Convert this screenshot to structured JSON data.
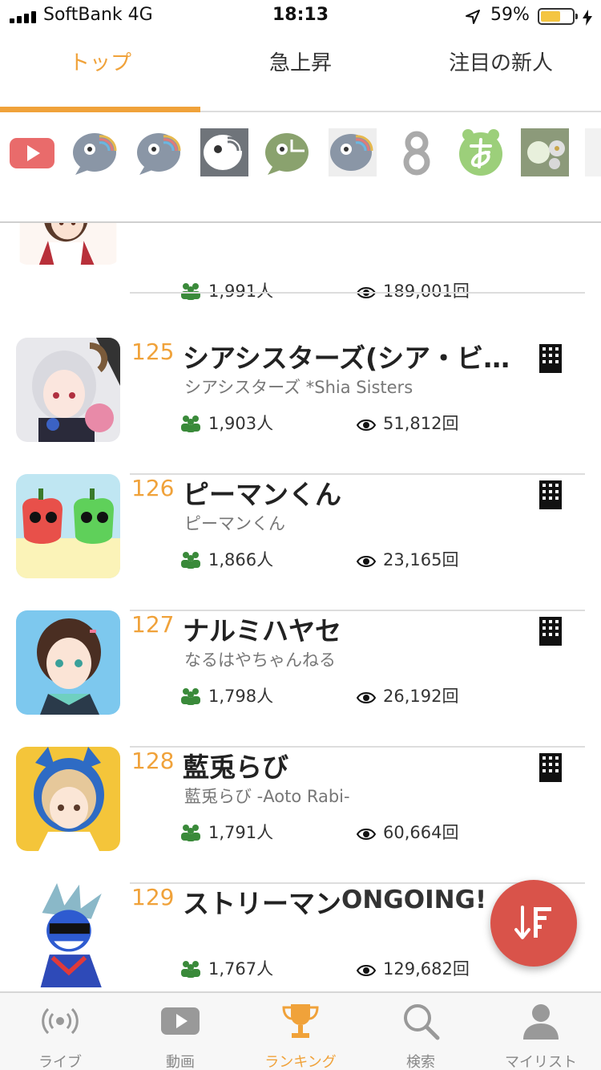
{
  "status_bar": {
    "carrier": "SoftBank  4G",
    "time": "18:13",
    "battery_percent": "59%"
  },
  "tabs": [
    {
      "label": "トップ",
      "active": true
    },
    {
      "label": "急上昇",
      "active": false
    },
    {
      "label": "注目の新人",
      "active": false
    }
  ],
  "channel_icons": [
    "youtube-icon",
    "showroom-icon",
    "showroom-icon",
    "showroom-icon",
    "showroom-icon",
    "showroom-icon",
    "eight-icon",
    "a-hiragana-icon",
    "mascot-icon",
    "more-icon"
  ],
  "top_row": {
    "subscribers": "1,991人",
    "views": "189,001回"
  },
  "rankings": [
    {
      "rank": "125",
      "name": "シアシスターズ(シア・ビビ…",
      "channel": "シアシスターズ *Shia Sisters",
      "subscribers": "1,903人",
      "views": "51,812回"
    },
    {
      "rank": "126",
      "name": "ピーマンくん",
      "channel": "ピーマンくん",
      "subscribers": "1,866人",
      "views": "23,165回"
    },
    {
      "rank": "127",
      "name": "ナルミハヤセ",
      "channel": "なるはやちゃんねる",
      "subscribers": "1,798人",
      "views": "26,192回"
    },
    {
      "rank": "128",
      "name": "藍兎らび",
      "channel": "藍兎らび -Aoto Rabi-",
      "subscribers": "1,791人",
      "views": "60,664回"
    },
    {
      "rank": "129",
      "name": "ストリーマン",
      "channel": "",
      "subscribers": "1,767人",
      "views": "129,682回"
    }
  ],
  "overlay_text": "ONGOING!",
  "bottom_nav": [
    {
      "label": "ライブ",
      "icon": "live-icon",
      "active": false
    },
    {
      "label": "動画",
      "icon": "video-icon",
      "active": false
    },
    {
      "label": "ランキング",
      "icon": "trophy-icon",
      "active": true
    },
    {
      "label": "検索",
      "icon": "search-icon",
      "active": false
    },
    {
      "label": "マイリスト",
      "icon": "person-icon",
      "active": false
    }
  ],
  "colors": {
    "accent": "#f0a23a",
    "fab": "#d9534a",
    "subscriber_icon": "#3a8a3a"
  }
}
